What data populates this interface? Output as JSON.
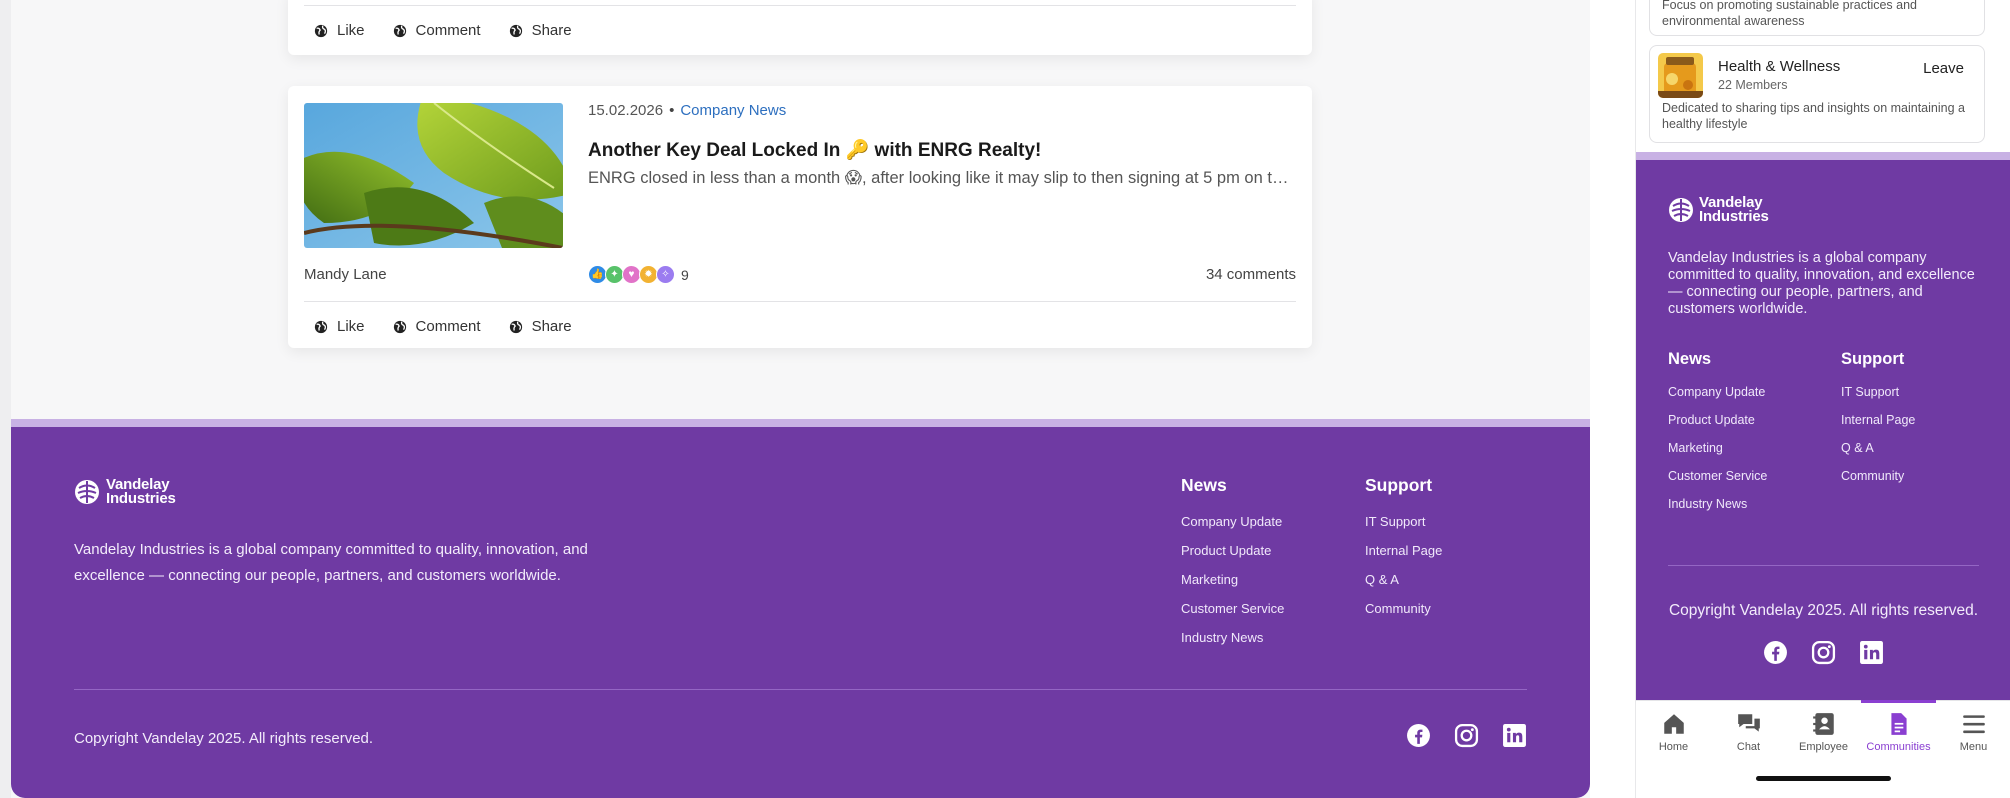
{
  "feed": {
    "post_actions": {
      "like": "Like",
      "comment": "Comment",
      "share": "Share"
    },
    "post": {
      "date": "15.02.2026",
      "category": "Company News",
      "title": "Another Key Deal Locked In 🔑 with ENRG Realty!",
      "excerpt": "ENRG closed in less than a month 😱, after looking like it may slip to then signing at 5 pm on the final day of the quarter.",
      "author": "Mandy Lane",
      "reaction_count": "9",
      "comments": "34 comments"
    }
  },
  "footer": {
    "logo_line1": "Vandelay",
    "logo_line2": "Industries",
    "description": "Vandelay Industries is a global company committed to quality, innovation, and excellence — connecting our people, partners, and customers worldwide.",
    "news": {
      "heading": "News",
      "links": [
        "Company Update",
        "Product Update",
        "Marketing",
        "Customer Service",
        "Industry News"
      ]
    },
    "support": {
      "heading": "Support",
      "links": [
        "IT Support",
        "Internal Page",
        "Q & A",
        "Community"
      ]
    },
    "copyright": "Copyright Vandelay 2025. All rights reserved.",
    "social_icons": [
      "facebook-icon",
      "instagram-icon",
      "linkedin-icon"
    ]
  },
  "mobile": {
    "partial_group_desc": "Focus on promoting sustainable practices and environmental awareness",
    "group": {
      "name": "Health & Wellness",
      "members": "22 Members",
      "action": "Leave",
      "description": "Dedicated to sharing tips and insights on maintaining a healthy lifestyle"
    },
    "tabs": [
      {
        "label": "Home",
        "icon": "home-icon"
      },
      {
        "label": "Chat",
        "icon": "chat-icon"
      },
      {
        "label": "Employee",
        "icon": "employee-icon"
      },
      {
        "label": "Communities",
        "icon": "communities-icon",
        "active": true
      },
      {
        "label": "Menu",
        "icon": "menu-icon"
      }
    ]
  },
  "colors": {
    "footer_bg": "#6f3aa3",
    "footer_top_border": "#c8b1e4",
    "link_blue": "#2d6fbf",
    "active_tab": "#8a3fd1"
  }
}
